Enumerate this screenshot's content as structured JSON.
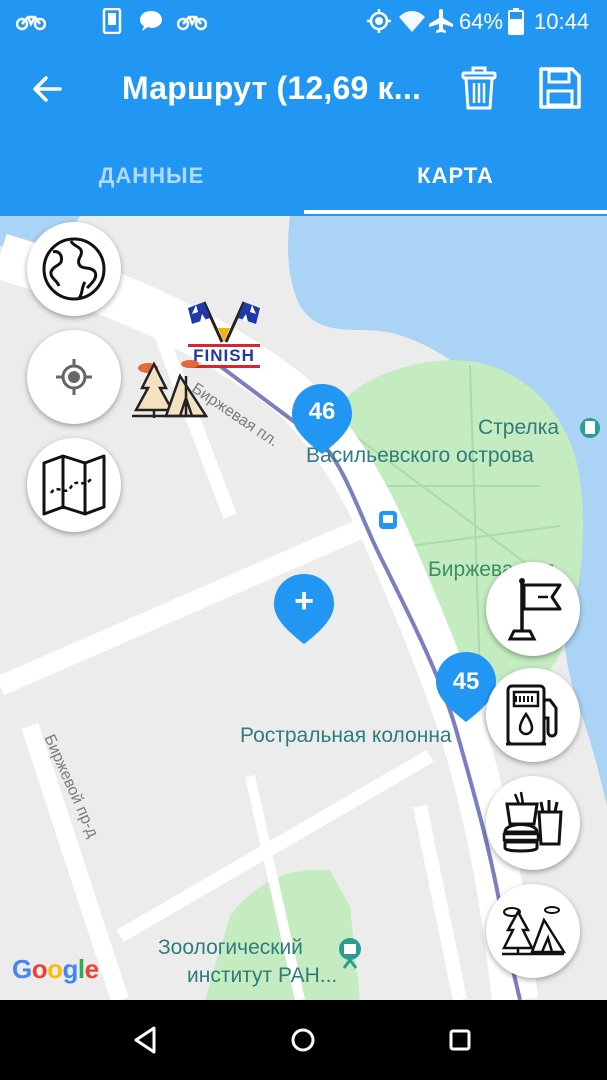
{
  "status_bar": {
    "battery": "64%",
    "time": "10:44"
  },
  "app_bar": {
    "title": "Маршрут (12,69 к...",
    "icons": [
      "back-arrow-icon",
      "trash-icon",
      "save-icon"
    ]
  },
  "tabs": [
    {
      "label": "ДАННЫЕ",
      "active": false
    },
    {
      "label": "КАРТА",
      "active": true
    }
  ],
  "map": {
    "places": {
      "strelka_line1": "Стрелка",
      "strelka_line2": "Васильевского острова",
      "birzhevaya_park": "Биржевая пл.",
      "rostral": "Ростральная колонна",
      "zoo_line1": "Зоологический",
      "zoo_line2": "институт РАН..."
    },
    "streets": {
      "birzhevaya_pl": "Биржевая пл.",
      "birzhevoy_pr": "Биржевой пр-д"
    },
    "markers": {
      "waypoint_46": "46",
      "waypoint_45": "45",
      "add": "+"
    },
    "finish_text": "FINISH",
    "logo": "Google",
    "colors": {
      "water": "#aad3f5",
      "park": "#c4ecc0",
      "route": "#7b7fbf",
      "marker": "#2196f3",
      "accent": "#2196f3"
    }
  },
  "left_buttons": [
    "globe-icon",
    "my-location-icon",
    "map-icon"
  ],
  "right_buttons": [
    "flag-icon",
    "fuel-station-icon",
    "fast-food-icon",
    "camping-icon"
  ],
  "nav_bar": [
    "back-triangle-icon",
    "home-circle-icon",
    "recents-square-icon"
  ]
}
